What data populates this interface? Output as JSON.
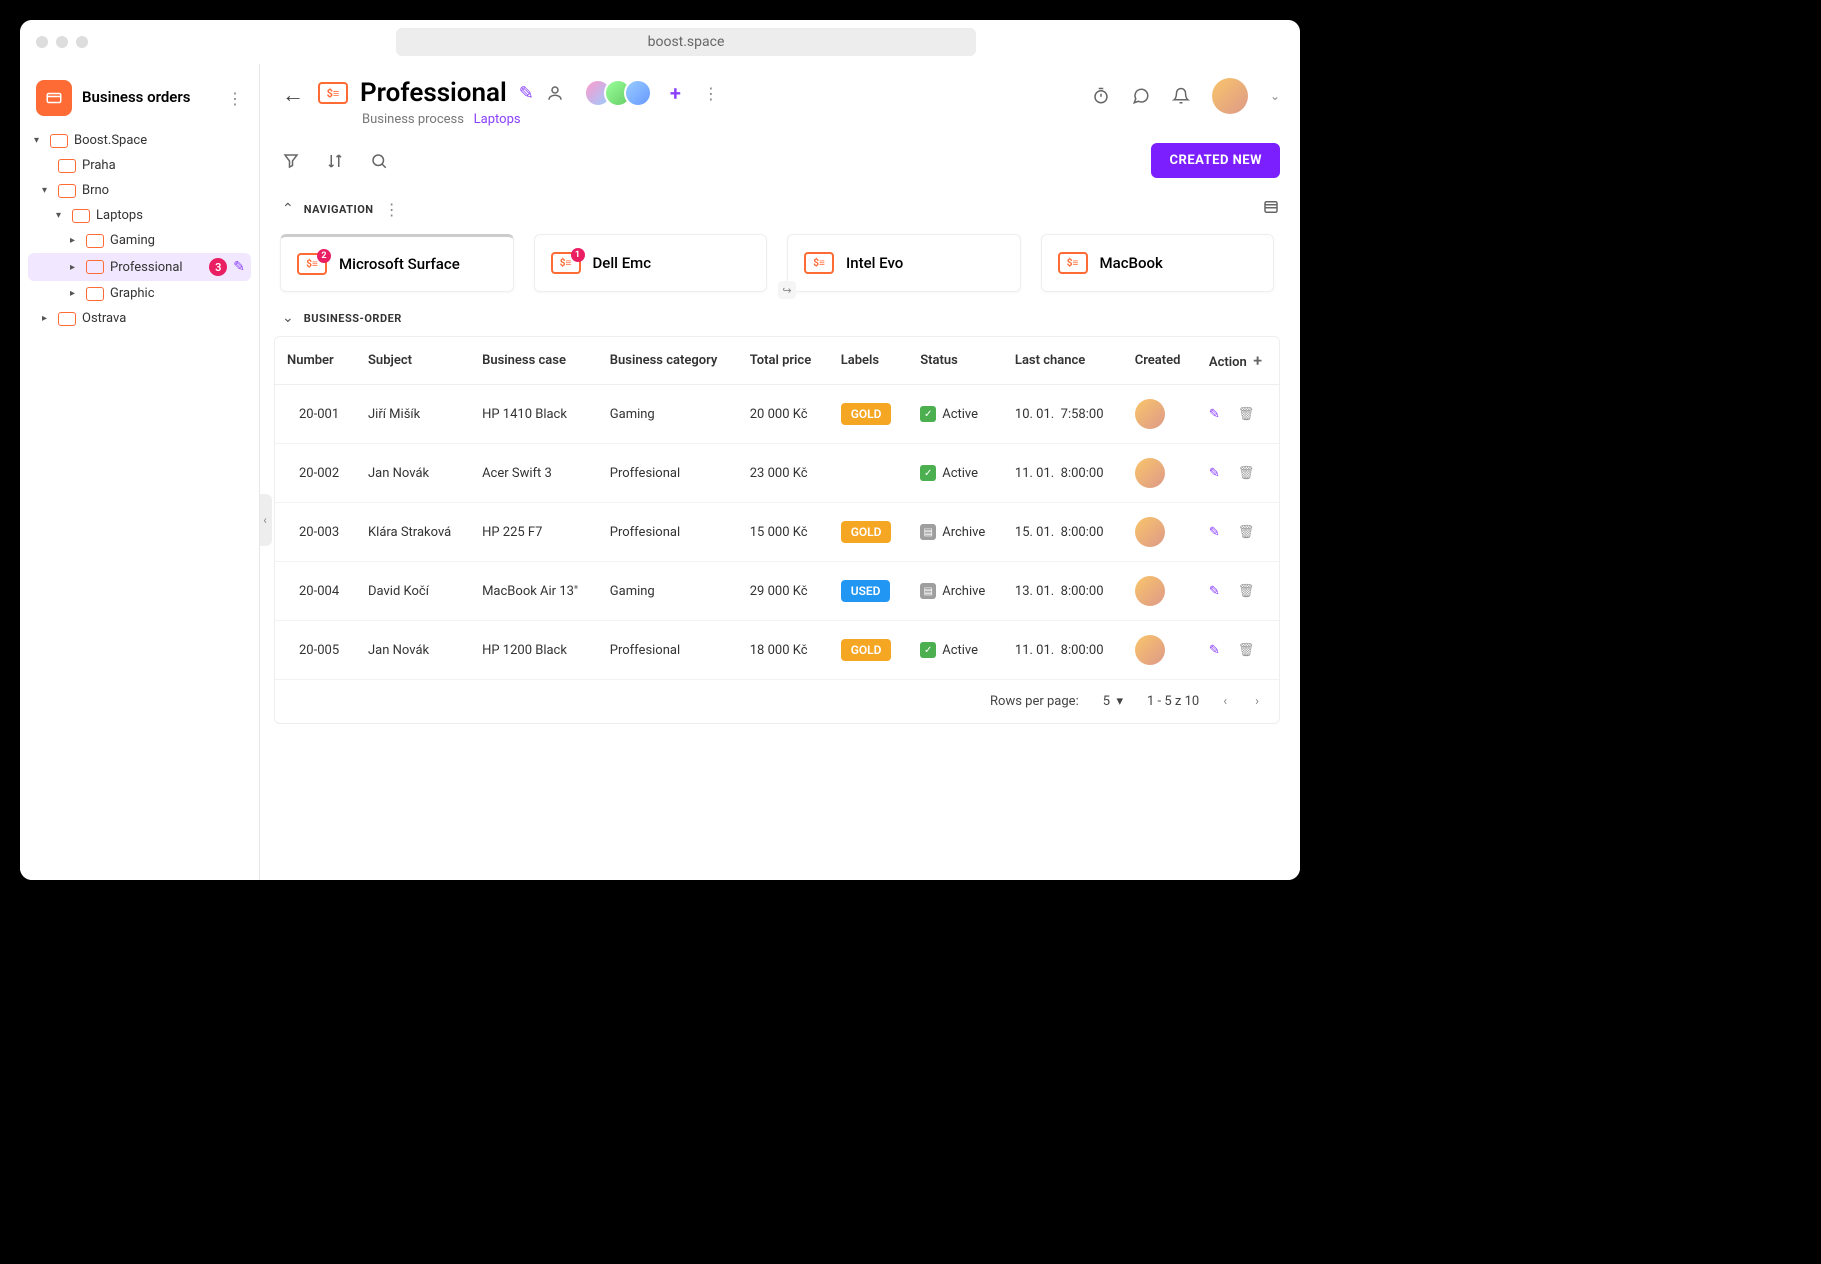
{
  "browser": {
    "url": "boost.space"
  },
  "sidebar": {
    "title": "Business orders",
    "tree": {
      "root": "Boost.Space",
      "praha": "Praha",
      "brno": "Brno",
      "laptops": "Laptops",
      "gaming": "Gaming",
      "professional": "Professional",
      "professional_count": "3",
      "graphic": "Graphic",
      "ostrava": "Ostrava"
    }
  },
  "header": {
    "title": "Professional",
    "crumb1": "Business process",
    "crumb2": "Laptops"
  },
  "actions": {
    "create": "CREATED NEW"
  },
  "navSection": {
    "label": "NAVIGATION"
  },
  "cards": {
    "c1": {
      "label": "Microsoft Surface",
      "badge": "2"
    },
    "c2": {
      "label": "Dell Emc",
      "badge": "1"
    },
    "c3": {
      "label": "Intel Evo"
    },
    "c4": {
      "label": "MacBook"
    }
  },
  "bizSection": {
    "label": "BUSINESS-ORDER"
  },
  "table": {
    "cols": {
      "number": "Number",
      "subject": "Subject",
      "case": "Business case",
      "category": "Business category",
      "total": "Total price",
      "labels": "Labels",
      "status": "Status",
      "lastchance": "Last chance",
      "created": "Created",
      "action": "Action"
    },
    "rows": [
      {
        "num": "20-001",
        "subj": "Jiří Mišík",
        "case": "HP 1410 Black",
        "cat": "Gaming",
        "total": "20 000 Kč",
        "label": "GOLD",
        "labelClass": "gold",
        "status": "Active",
        "statusClass": "active",
        "date": "10. 01.",
        "time": "7:58:00"
      },
      {
        "num": "20-002",
        "subj": "Jan Novák",
        "case": "Acer Swift 3",
        "cat": "Proffesional",
        "total": "23 000 Kč",
        "label": "",
        "labelClass": "",
        "status": "Active",
        "statusClass": "active",
        "date": "11. 01.",
        "time": "8:00:00"
      },
      {
        "num": "20-003",
        "subj": "Klára Straková",
        "case": "HP 225 F7",
        "cat": "Proffesional",
        "total": "15 000 Kč",
        "label": "GOLD",
        "labelClass": "gold",
        "status": "Archive",
        "statusClass": "archive",
        "date": "15. 01.",
        "time": "8:00:00"
      },
      {
        "num": "20-004",
        "subj": "David Kočí",
        "case": "MacBook Air 13\"",
        "cat": "Gaming",
        "total": "29 000 Kč",
        "label": "USED",
        "labelClass": "used",
        "status": "Archive",
        "statusClass": "archive",
        "date": "13. 01.",
        "time": "8:00:00"
      },
      {
        "num": "20-005",
        "subj": "Jan Novák",
        "case": "HP 1200 Black",
        "cat": "Proffesional",
        "total": "18 000 Kč",
        "label": "GOLD",
        "labelClass": "gold",
        "status": "Active",
        "statusClass": "active",
        "date": "11. 01.",
        "time": "8:00:00"
      }
    ],
    "footer": {
      "rows_label": "Rows per page:",
      "rows_value": "5",
      "range": "1 - 5 z 10"
    }
  }
}
